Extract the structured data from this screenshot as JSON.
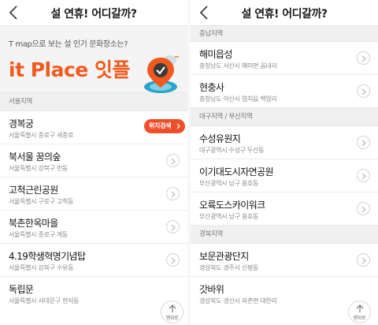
{
  "left": {
    "title": "설 연휴! 어디갈까?",
    "banner": {
      "subtitle": "T map으로 보는 설 인기 문화장소는?",
      "logo_text": "it Place 잇플"
    },
    "sections": [
      {
        "label": "서울지역",
        "items": [
          {
            "name": "경복궁",
            "address": "서울특별시 종로구 세종로",
            "badge": "위치검색"
          },
          {
            "name": "북서울 꿈의숲",
            "address": "서울특별시 강북구 번동"
          },
          {
            "name": "고척근린공원",
            "address": "서울특별시 구로구 고척동"
          },
          {
            "name": "북촌한옥마을",
            "address": "서울특별시 종로구 계동"
          },
          {
            "name": "4.19학생혁명기념탑",
            "address": "서울특별시 강북구 수유동"
          },
          {
            "name": "독립문",
            "address": "서울특별시 서대문구 현저동"
          }
        ]
      }
    ],
    "top_button_label": "맨위로"
  },
  "right": {
    "title": "설 연휴! 어디갈까?",
    "sections": [
      {
        "label": "충남지역",
        "items": [
          {
            "name": "해미읍성",
            "address": "충청남도 서산시 해미면 읍내리"
          },
          {
            "name": "현충사",
            "address": "충청남도 아산시 염치읍 백암리"
          }
        ]
      },
      {
        "label": "대구지역 / 부산지역",
        "items": [
          {
            "name": "수성유원지",
            "address": "대구광역시 수성구 두산동"
          },
          {
            "name": "이기대도시자연공원",
            "address": "부산광역시 남구 용호동"
          },
          {
            "name": "오륙도스카이워크",
            "address": "부산광역시 남구 용호동"
          }
        ]
      },
      {
        "label": "경북지역",
        "items": [
          {
            "name": "보문관광단지",
            "address": "경상북도 경주시 신평동"
          },
          {
            "name": "갓바위",
            "address": "경상북도 경산시 와촌면 대한리"
          }
        ]
      }
    ],
    "top_button_label": "맨위로"
  },
  "colors": {
    "accent": "#ee4f2a",
    "logo": "#f05a1e",
    "section_bg": "#f0f0f0"
  }
}
